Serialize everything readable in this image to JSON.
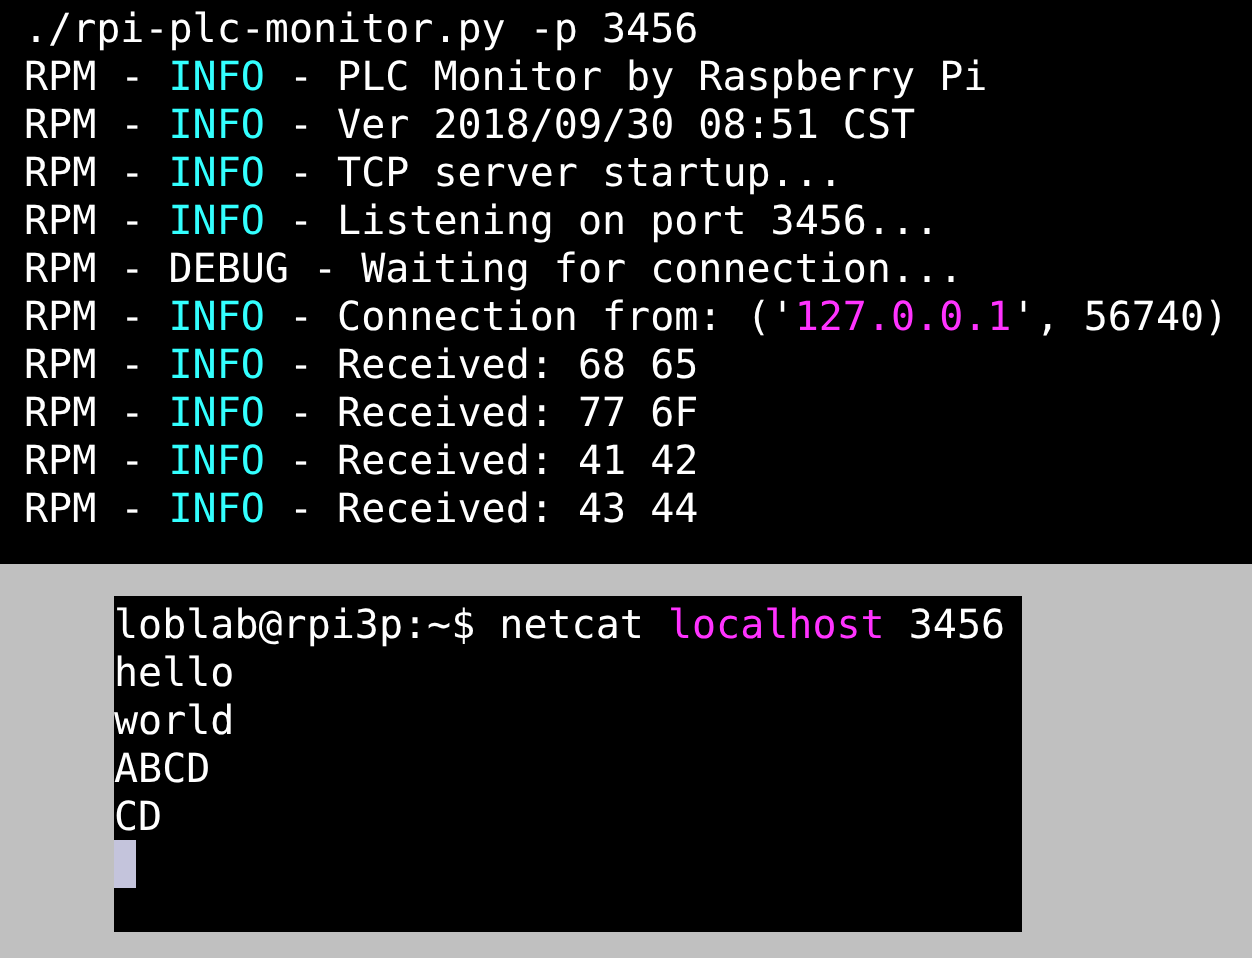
{
  "server_terminal": {
    "lines": [
      [
        {
          "text": "./rpi-plc-monitor.py -p 3456",
          "kind": "plain"
        }
      ],
      [
        {
          "text": "RPM - ",
          "kind": "plain"
        },
        {
          "text": "INFO",
          "kind": "level"
        },
        {
          "text": " - PLC Monitor by Raspberry Pi",
          "kind": "plain"
        }
      ],
      [
        {
          "text": "RPM - ",
          "kind": "plain"
        },
        {
          "text": "INFO",
          "kind": "level"
        },
        {
          "text": " - Ver 2018/09/30 08:51 CST",
          "kind": "plain"
        }
      ],
      [
        {
          "text": "RPM - ",
          "kind": "plain"
        },
        {
          "text": "INFO",
          "kind": "level"
        },
        {
          "text": " - TCP server startup...",
          "kind": "plain"
        }
      ],
      [
        {
          "text": "RPM - ",
          "kind": "plain"
        },
        {
          "text": "INFO",
          "kind": "level"
        },
        {
          "text": " - Listening on port 3456...",
          "kind": "plain"
        }
      ],
      [
        {
          "text": "RPM - DEBUG - Waiting for connection...",
          "kind": "plain"
        }
      ],
      [
        {
          "text": "RPM - ",
          "kind": "plain"
        },
        {
          "text": "INFO",
          "kind": "level"
        },
        {
          "text": " - Connection from: ('",
          "kind": "plain"
        },
        {
          "text": "127.0.0.1",
          "kind": "string"
        },
        {
          "text": "', 56740)",
          "kind": "plain"
        }
      ],
      [
        {
          "text": "RPM - ",
          "kind": "plain"
        },
        {
          "text": "INFO",
          "kind": "level"
        },
        {
          "text": " - Received: 68 65",
          "kind": "plain"
        }
      ],
      [
        {
          "text": "RPM - ",
          "kind": "plain"
        },
        {
          "text": "INFO",
          "kind": "level"
        },
        {
          "text": " - Received: 77 6F",
          "kind": "plain"
        }
      ],
      [
        {
          "text": "RPM - ",
          "kind": "plain"
        },
        {
          "text": "INFO",
          "kind": "level"
        },
        {
          "text": " - Received: 41 42",
          "kind": "plain"
        }
      ],
      [
        {
          "text": "RPM - ",
          "kind": "plain"
        },
        {
          "text": "INFO",
          "kind": "level"
        },
        {
          "text": " - Received: 43 44",
          "kind": "plain"
        }
      ]
    ]
  },
  "client_terminal": {
    "lines": [
      [
        {
          "text": "loblab@rpi3p:~$ netcat ",
          "kind": "plain"
        },
        {
          "text": "localhost",
          "kind": "string"
        },
        {
          "text": " 3456",
          "kind": "plain"
        }
      ],
      [
        {
          "text": "hello",
          "kind": "plain"
        }
      ],
      [
        {
          "text": "world",
          "kind": "plain"
        }
      ],
      [
        {
          "text": "ABCD",
          "kind": "plain"
        }
      ],
      [
        {
          "text": "CD",
          "kind": "plain"
        }
      ]
    ],
    "cursor": {
      "visible": true
    }
  }
}
